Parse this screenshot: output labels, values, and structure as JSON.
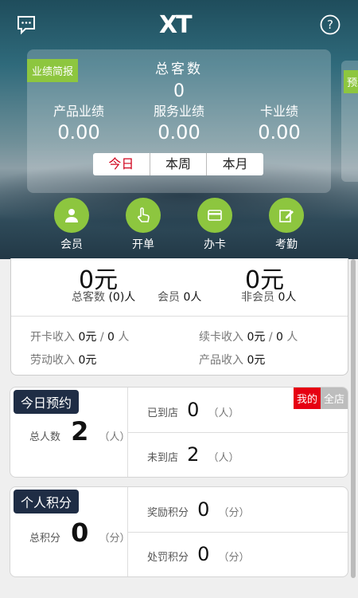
{
  "header": {
    "logo": "XT",
    "chat_icon": "chat-icon",
    "help_icon": "help-icon"
  },
  "summary_card": {
    "tag": "业绩简报",
    "title": "总客数",
    "total": "0",
    "metrics": [
      {
        "label": "产品业绩",
        "value": "0.00"
      },
      {
        "label": "服务业绩",
        "value": "0.00"
      },
      {
        "label": "卡业绩",
        "value": "0.00"
      }
    ],
    "periods": [
      "今日",
      "本周",
      "本月"
    ],
    "active_period": "今日",
    "next_card_tag": "预约"
  },
  "actions": [
    {
      "label": "会员",
      "icon": "member-icon"
    },
    {
      "label": "开单",
      "icon": "tap-icon"
    },
    {
      "label": "办卡",
      "icon": "card-icon"
    },
    {
      "label": "考勤",
      "icon": "edit-icon"
    }
  ],
  "revenue": {
    "left_amount": "0元",
    "right_amount": "0元",
    "guests_label": "总客数",
    "guests_value": "(0)人",
    "member_label": "会员",
    "member_value": "0人",
    "nonmember_label": "非会员",
    "nonmember_value": "0人",
    "open_card_label": "开卡收入",
    "open_card_amount": "0元",
    "open_card_sep": "/",
    "open_card_count": "0",
    "open_card_unit": "人",
    "renew_label": "续卡收入",
    "renew_amount": "0元",
    "renew_sep": "/",
    "renew_count": "0",
    "renew_unit": "人",
    "labor_label": "劳动收入",
    "labor_value": "0元",
    "product_label": "产品收入",
    "product_value": "0元"
  },
  "appointments": {
    "tag": "今日预约",
    "total_label": "总人数",
    "total_value": "2",
    "unit": "（人）",
    "arrived_label": "已到店",
    "arrived_value": "0",
    "not_arrived_label": "未到店",
    "not_arrived_value": "2",
    "toggle_mine": "我的",
    "toggle_all": "全店"
  },
  "points": {
    "tag": "个人积分",
    "total_label": "总积分",
    "total_value": "0",
    "unit": "（分）",
    "reward_label": "奖励积分",
    "reward_value": "0",
    "penalty_label": "处罚积分",
    "penalty_value": "0"
  }
}
